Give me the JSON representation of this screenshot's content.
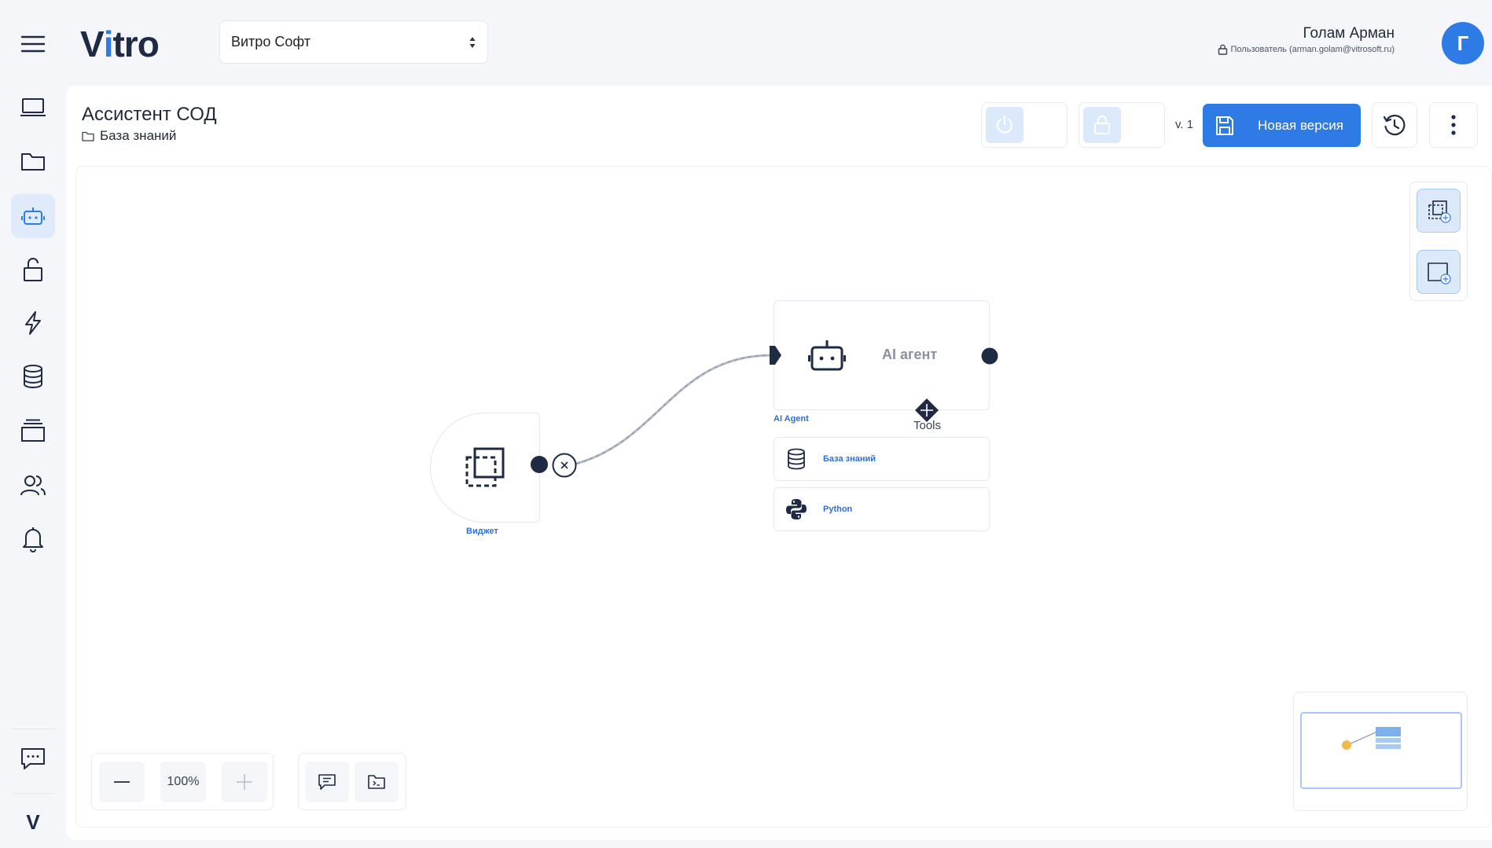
{
  "header": {
    "logo_text_1": "V",
    "logo_text_2": "i",
    "logo_text_3": "tro",
    "org_select_value": "Витро Софт",
    "user_name": "Голам Арман",
    "user_role": "Пользователь (arman.golam@vitrosoft.ru)",
    "avatar_letter": "Г"
  },
  "sidebar": {
    "items": [
      {
        "icon": "monitor-icon"
      },
      {
        "icon": "folder-icon"
      },
      {
        "icon": "robot-icon",
        "active": true
      },
      {
        "icon": "unlock-icon"
      },
      {
        "icon": "lightning-icon"
      },
      {
        "icon": "database-icon"
      },
      {
        "icon": "layers-icon"
      },
      {
        "icon": "users-icon"
      },
      {
        "icon": "bell-icon"
      }
    ],
    "bottom": [
      {
        "icon": "chat-icon"
      },
      {
        "icon": "vitro-mini-logo"
      }
    ],
    "mini_logo_letter": "V"
  },
  "page": {
    "title": "Ассистент СОД",
    "breadcrumb": "База знаний"
  },
  "toolbar": {
    "version": "v. 1",
    "new_version_label": "Новая версия"
  },
  "canvas": {
    "widget_node_label": "Виджет",
    "agent_node_title": "AI агент",
    "agent_node_label": "AI Agent",
    "tools_label": "Tools",
    "tool_nodes": [
      {
        "label": "База знаний",
        "icon": "database-icon"
      },
      {
        "label": "Python",
        "icon": "python-icon"
      }
    ],
    "zoom_value": "100%"
  },
  "colors": {
    "accent": "#2f7be5",
    "accent_light": "#dbe9fb",
    "node_dark": "#1f2a44",
    "label_blue": "#2f6fd6"
  }
}
